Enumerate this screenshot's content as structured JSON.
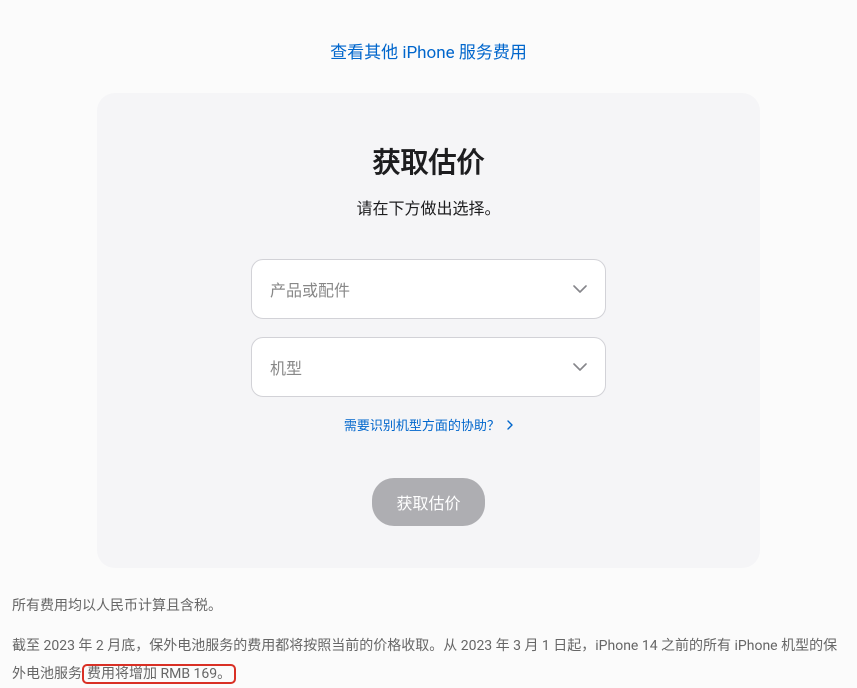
{
  "topLink": {
    "label": "查看其他 iPhone 服务费用"
  },
  "card": {
    "title": "获取估价",
    "subtitle": "请在下方做出选择。",
    "selects": {
      "product": {
        "placeholder": "产品或配件"
      },
      "model": {
        "placeholder": "机型"
      }
    },
    "helpLink": {
      "label": "需要识别机型方面的协助？"
    },
    "submit": {
      "label": "获取估价"
    }
  },
  "disclaimer": {
    "line1": "所有费用均以人民币计算且含税。",
    "line2_prefix": "截至 2023 年 2 月底，保外电池服务的费用都将按照当前的价格收取。从 2023 年 3 月 1 日起，iPhone 14 之前的所有 iPhone 机型的保外电池服务",
    "line2_highlight": "费用将增加 RMB 169。"
  }
}
